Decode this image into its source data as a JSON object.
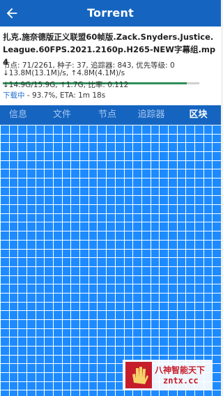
{
  "header": {
    "title": "Torrent",
    "back_icon": "arrow-left-icon"
  },
  "torrent": {
    "name": "扎克.施奈德版正义联盟60帧版.Zack.Snyders.Justice.League.60FPS.2021.2160p.H265-NEW字幕组.mp4",
    "progress": 0.937,
    "progress_color": "#2e8f5a",
    "peers_line": "节点: 71/2261, 种子: 37, 追踪器: 843, 优先等级: 0",
    "speed_line": "↓13.8M(13.1M)/s, ↑4.8M(4.1M)/s",
    "size_line": "↓14.9G/15.9G, ↑1.7G, 比率: 0.112",
    "status_word": "下载中",
    "status_rest": " - 93.7%, ETA: 1m 18s"
  },
  "tabs": [
    {
      "label": "信息",
      "active": false
    },
    {
      "label": "文件",
      "active": false
    },
    {
      "label": "节点",
      "active": false
    },
    {
      "label": "追踪器",
      "active": false
    },
    {
      "label": "区块",
      "active": true
    }
  ],
  "pieces": {
    "cell_color": "#1d8bff",
    "line_color": "#ffffff",
    "columns": 25
  },
  "watermark": {
    "line1": "八神智能天下",
    "line2": "zntx.cc"
  },
  "colors": {
    "primary": "#1565c0",
    "tab_inactive": "#a9c6f0",
    "status_link": "#1e6fd0"
  }
}
